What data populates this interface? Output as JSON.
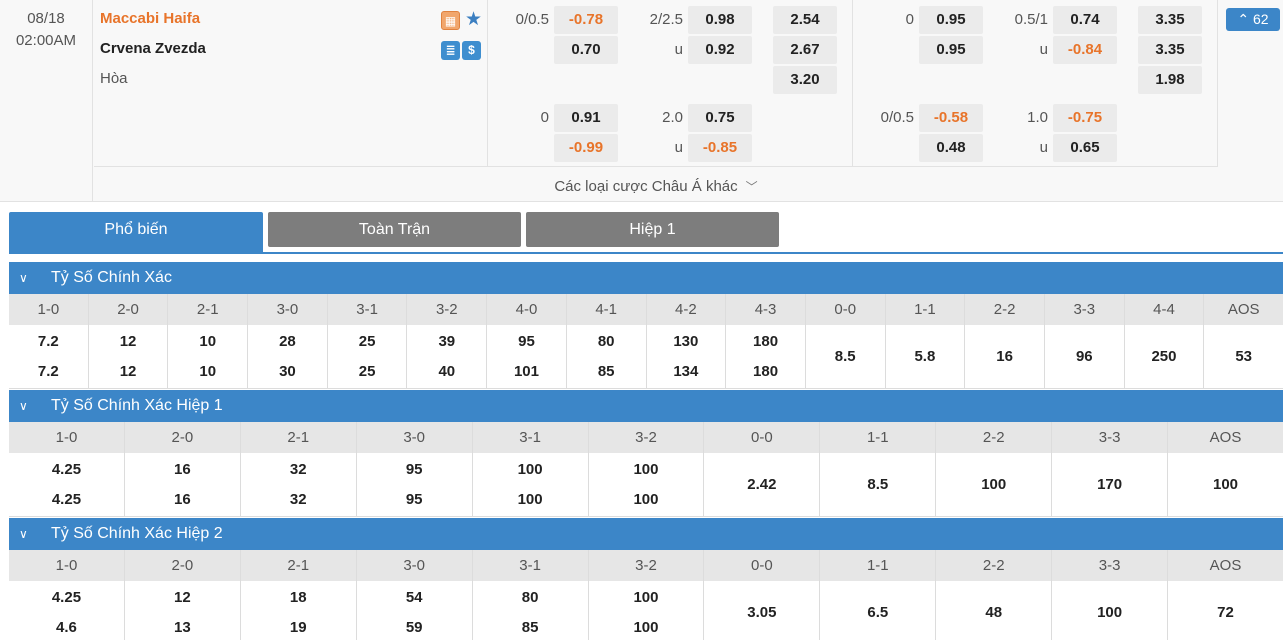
{
  "match": {
    "date": "08/18",
    "time": "02:00AM",
    "home": "Maccabi Haifa",
    "away": "Crvena Zvezda",
    "draw": "Hòa",
    "more_count": "62",
    "other_bets": "Các loại cược Châu Á khác"
  },
  "odds_ft": {
    "hdp1": {
      "line": "0/0.5",
      "home": "-0.78",
      "away": "0.70"
    },
    "ou1": {
      "line": "2/2.5",
      "over": "0.98",
      "under_label": "u",
      "under": "0.92"
    },
    "x12": {
      "home": "2.54",
      "away": "2.67",
      "draw": "3.20"
    },
    "hdp2": {
      "line": "0",
      "home": "0.91",
      "away": "-0.99"
    },
    "ou2": {
      "line": "2.0",
      "over": "0.75",
      "under_label": "u",
      "under": "-0.85"
    }
  },
  "odds_h1": {
    "hdp1": {
      "line": "0",
      "home": "0.95",
      "away": "0.95"
    },
    "ou1": {
      "line": "0.5/1",
      "over": "0.74",
      "under_label": "u",
      "under": "-0.84"
    },
    "x12": {
      "home": "3.35",
      "away": "3.35",
      "draw": "1.98"
    },
    "hdp2": {
      "line": "0/0.5",
      "home": "-0.58",
      "away": "0.48"
    },
    "ou2": {
      "line": "1.0",
      "over": "-0.75",
      "under_label": "u",
      "under": "0.65"
    }
  },
  "tabs": [
    "Phổ biến",
    "Toàn Trận",
    "Hiệp 1"
  ],
  "sections": [
    {
      "title": "Tỷ Số Chính Xác",
      "headers": [
        "1-0",
        "2-0",
        "2-1",
        "3-0",
        "3-1",
        "3-2",
        "4-0",
        "4-1",
        "4-2",
        "4-3",
        "0-0",
        "1-1",
        "2-2",
        "3-3",
        "4-4",
        "AOS"
      ],
      "values": [
        [
          "7.2",
          "7.2"
        ],
        [
          "12",
          "12"
        ],
        [
          "10",
          "10"
        ],
        [
          "28",
          "30"
        ],
        [
          "25",
          "25"
        ],
        [
          "39",
          "40"
        ],
        [
          "95",
          "101"
        ],
        [
          "80",
          "85"
        ],
        [
          "130",
          "134"
        ],
        [
          "180",
          "180"
        ],
        [
          "8.5"
        ],
        [
          "5.8"
        ],
        [
          "16"
        ],
        [
          "96"
        ],
        [
          "250"
        ],
        [
          "53"
        ]
      ]
    },
    {
      "title": "Tỷ Số Chính Xác Hiệp 1",
      "headers": [
        "1-0",
        "2-0",
        "2-1",
        "3-0",
        "3-1",
        "3-2",
        "0-0",
        "1-1",
        "2-2",
        "3-3",
        "AOS"
      ],
      "values": [
        [
          "4.25",
          "4.25"
        ],
        [
          "16",
          "16"
        ],
        [
          "32",
          "32"
        ],
        [
          "95",
          "95"
        ],
        [
          "100",
          "100"
        ],
        [
          "100",
          "100"
        ],
        [
          "2.42"
        ],
        [
          "8.5"
        ],
        [
          "100"
        ],
        [
          "170"
        ],
        [
          "100"
        ]
      ]
    },
    {
      "title": "Tỷ Số Chính Xác Hiệp 2",
      "headers": [
        "1-0",
        "2-0",
        "2-1",
        "3-0",
        "3-1",
        "3-2",
        "0-0",
        "1-1",
        "2-2",
        "3-3",
        "AOS"
      ],
      "values": [
        [
          "4.25",
          "4.6"
        ],
        [
          "12",
          "13"
        ],
        [
          "18",
          "19"
        ],
        [
          "54",
          "59"
        ],
        [
          "80",
          "85"
        ],
        [
          "100",
          "100"
        ],
        [
          "3.05"
        ],
        [
          "6.5"
        ],
        [
          "48"
        ],
        [
          "100"
        ],
        [
          "72"
        ]
      ]
    }
  ],
  "colors": {
    "accent": "#3c86c8",
    "negative": "#e8742a",
    "tab_inactive": "#7d7d7d"
  }
}
